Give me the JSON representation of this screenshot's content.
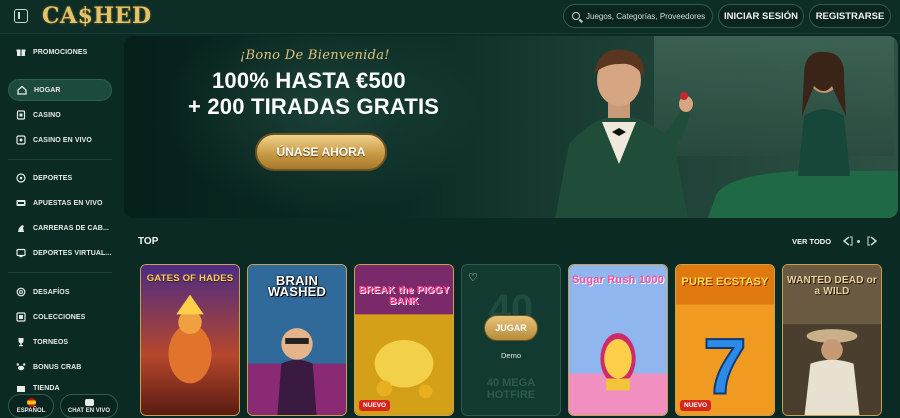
{
  "header": {
    "logo": "CA$HED",
    "search_placeholder": "Juegos, Categorías, Proveedores",
    "login_label": "INICIAR SESIÓN",
    "register_label": "REGISTRARSE"
  },
  "sidebar": {
    "items": [
      {
        "label": "PROMOCIONES",
        "icon": "gift-icon"
      },
      {
        "label": "HOGAR",
        "icon": "home-icon",
        "active": true
      },
      {
        "label": "CASINO",
        "icon": "casino-icon"
      },
      {
        "label": "CASINO EN VIVO",
        "icon": "live-casino-icon"
      },
      {
        "label": "DEPORTES",
        "icon": "sports-ball-icon"
      },
      {
        "label": "APUESTAS EN VIVO",
        "icon": "live-bets-icon"
      },
      {
        "label": "CARRERAS DE CAB...",
        "icon": "horse-icon"
      },
      {
        "label": "DEPORTES VIRTUAL...",
        "icon": "virtual-sports-icon"
      },
      {
        "label": "DESAFÍOS",
        "icon": "challenge-icon"
      },
      {
        "label": "COLECCIONES",
        "icon": "collections-icon"
      },
      {
        "label": "TORNEOS",
        "icon": "trophy-icon"
      },
      {
        "label": "BONUS CRAB",
        "icon": "crab-icon"
      },
      {
        "label": "TIENDA",
        "icon": "store-icon"
      }
    ],
    "lang_label": "ESPAÑOL",
    "chat_label": "CHAT EN VIVO"
  },
  "banner": {
    "subtitle": "¡Bono De Bienvenida!",
    "line1": "100% HASTA €500",
    "line2": "+ 200 TIRADAS GRATIS",
    "cta_label": "ÚNASE AHORA"
  },
  "top_section": {
    "title": "TOP",
    "see_all": "VER TODO"
  },
  "games": [
    {
      "title": "GATES OF HADES",
      "new": false
    },
    {
      "title": "BRAIN WASHED",
      "new": false
    },
    {
      "title": "BREAK the PIGGY BANK",
      "new": true,
      "new_label": "NUEVO"
    },
    {
      "title": "40 MEGA HOTFIRE",
      "play_label": "JUGAR",
      "demo_label": "Demo"
    },
    {
      "title": "Sugar Rush 1000",
      "new": false
    },
    {
      "title": "PURE ECSTASY",
      "new": true,
      "new_label": "NUEVO"
    },
    {
      "title": "WANTED DEAD or a WILD",
      "new": false
    }
  ]
}
